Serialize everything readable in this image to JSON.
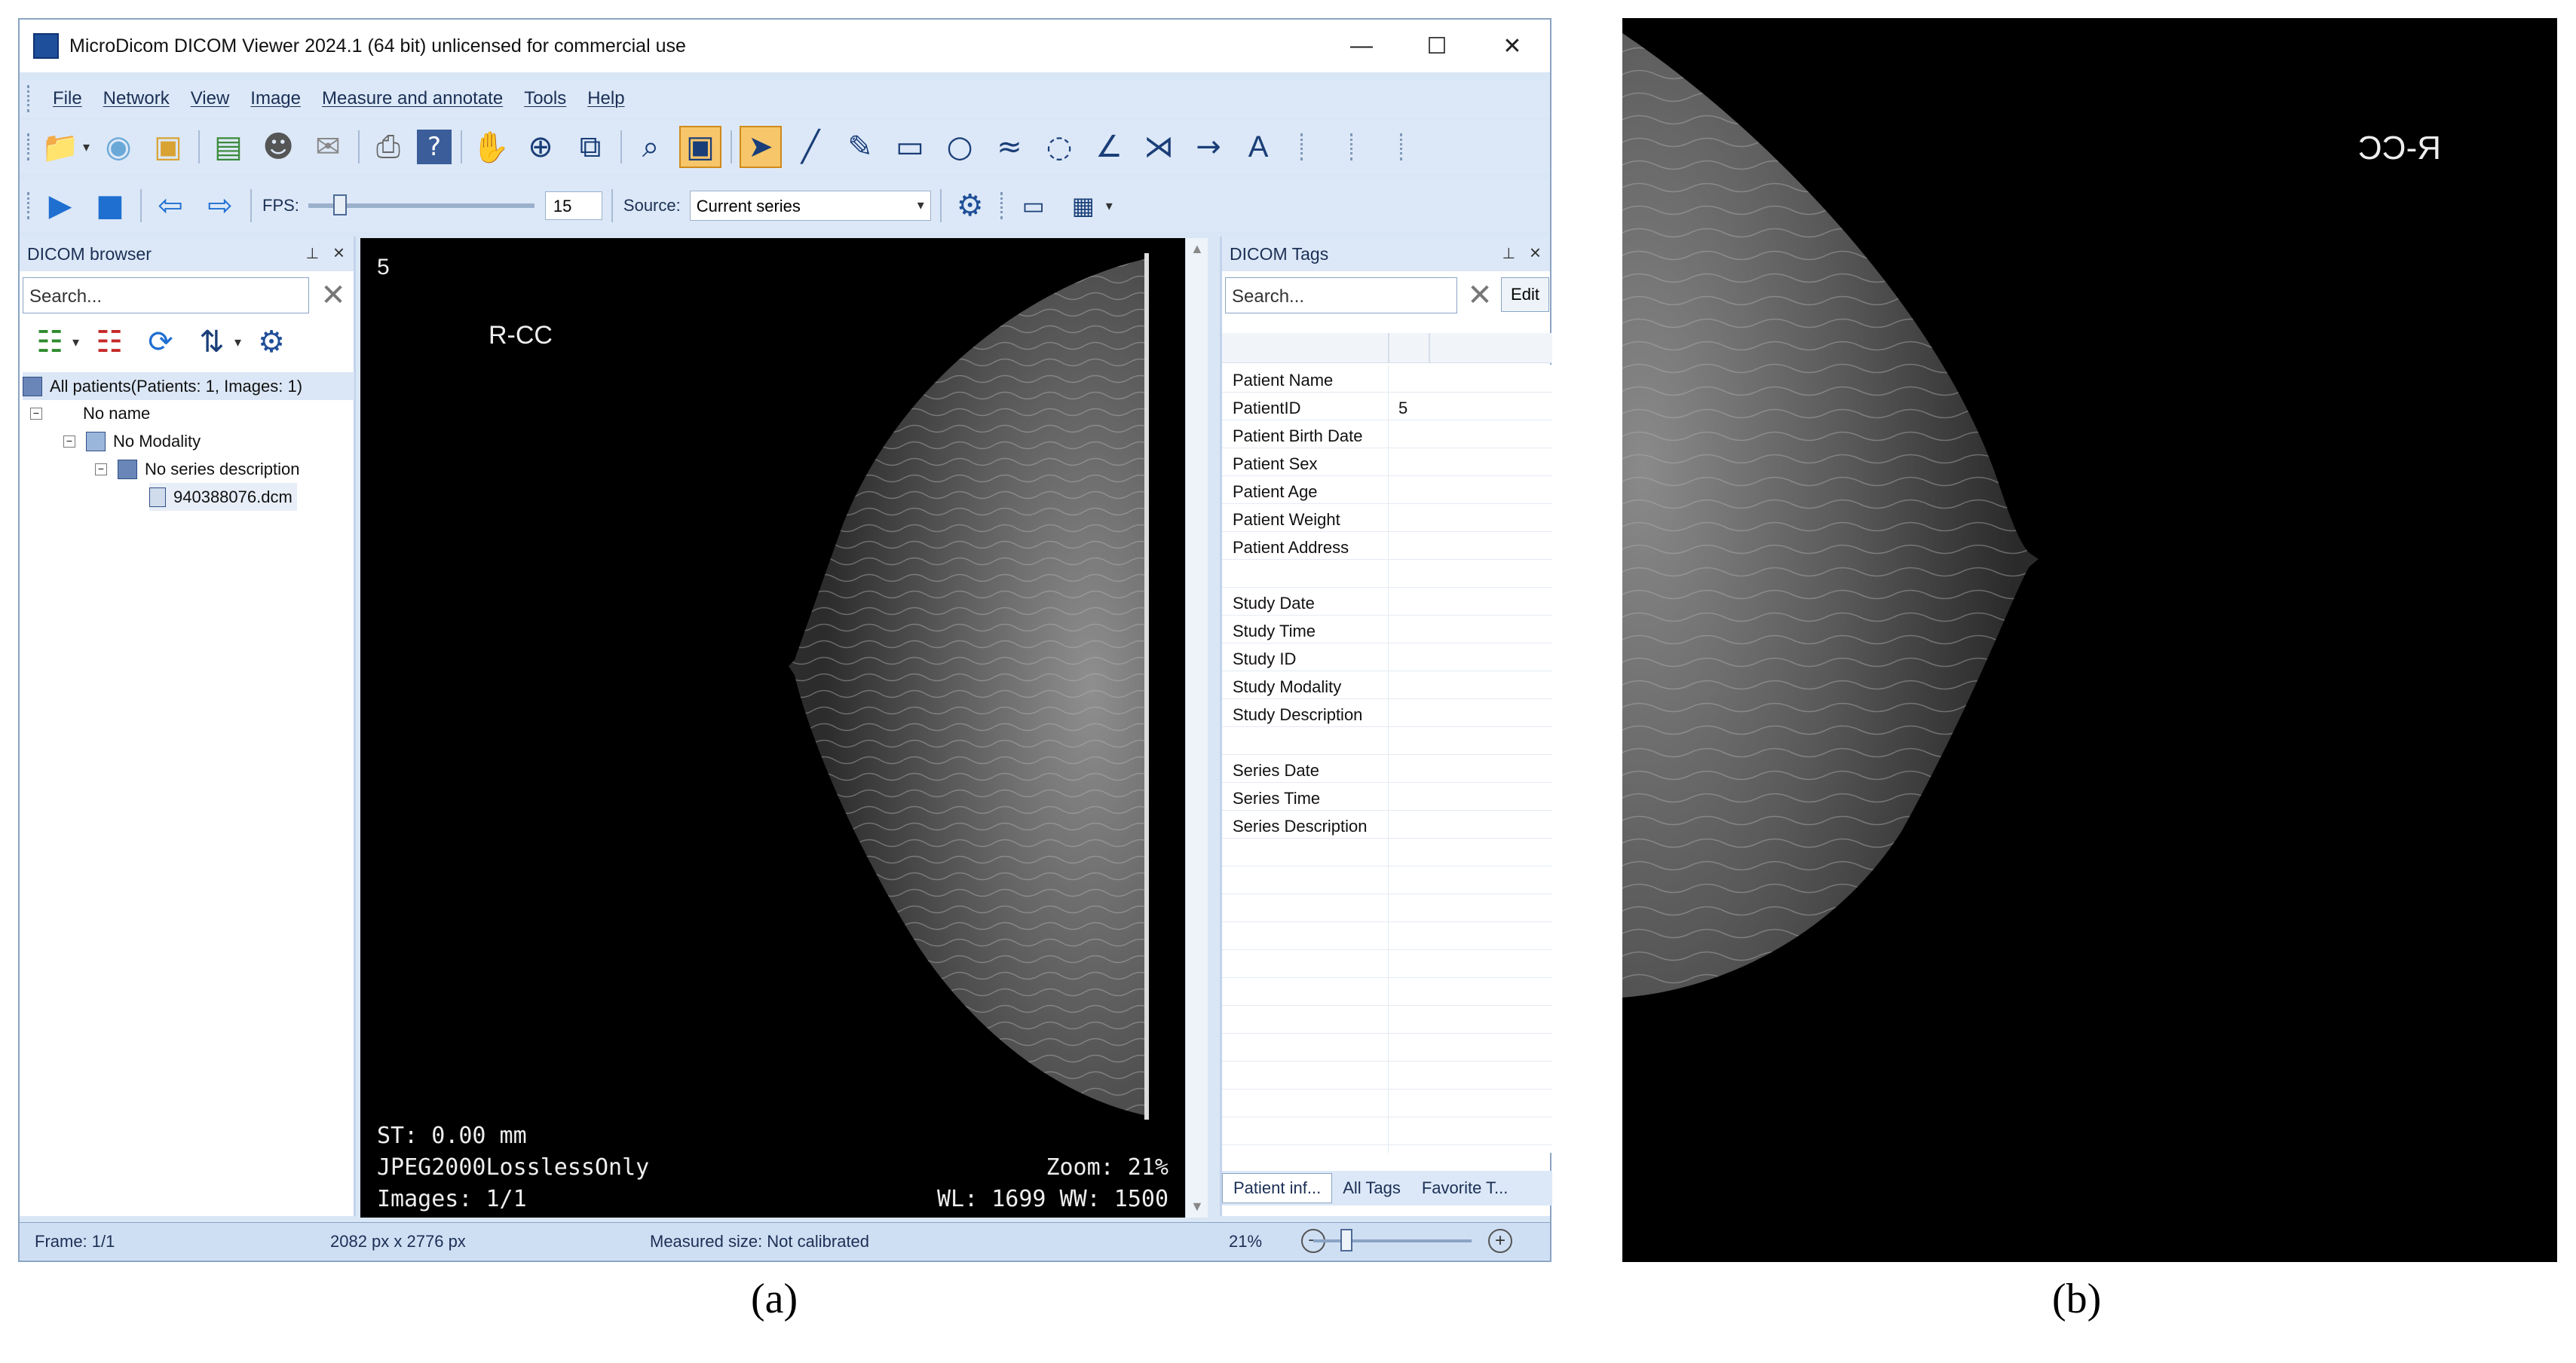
{
  "window": {
    "title": "MicroDicom DICOM Viewer 2024.1 (64 bit) unlicensed for commercial use",
    "controls": [
      "—",
      "☐",
      "✕"
    ]
  },
  "menu": [
    "File",
    "Network",
    "View",
    "Image",
    "Measure and annotate",
    "Tools",
    "Help"
  ],
  "toolbar2": {
    "fps_label": "FPS:",
    "fps_value": "15",
    "fps_slider_value": 0.11,
    "source_label": "Source:",
    "source_value": "Current series"
  },
  "dicom_browser": {
    "title": "DICOM browser",
    "search_placeholder": "Search...",
    "tree": [
      "All patients(Patients: 1, Images: 1)",
      "No name",
      "No Modality",
      "No series description",
      "940388076.dcm"
    ]
  },
  "viewer": {
    "frame_number": "5",
    "view_label": "R-CC",
    "st": "ST: 0.00 mm",
    "codec": "JPEG2000LosslessOnly",
    "images": "Images: 1/1",
    "zoom": "Zoom: 21%",
    "wl_ww": "WL: 1699 WW: 1500"
  },
  "dicom_tags": {
    "title": "DICOM Tags",
    "search_placeholder": "Search...",
    "edit_label": "Edit",
    "rows": [
      {
        "name": "Patient Name",
        "value": ""
      },
      {
        "name": "PatientID",
        "value": "5"
      },
      {
        "name": "Patient Birth Date",
        "value": ""
      },
      {
        "name": "Patient Sex",
        "value": ""
      },
      {
        "name": "Patient Age",
        "value": ""
      },
      {
        "name": "Patient Weight",
        "value": ""
      },
      {
        "name": "Patient Address",
        "value": ""
      },
      {
        "name": "",
        "value": ""
      },
      {
        "name": "Study Date",
        "value": ""
      },
      {
        "name": "Study Time",
        "value": ""
      },
      {
        "name": "Study ID",
        "value": ""
      },
      {
        "name": "Study Modality",
        "value": ""
      },
      {
        "name": "Study Description",
        "value": ""
      },
      {
        "name": "",
        "value": ""
      },
      {
        "name": "Series Date",
        "value": ""
      },
      {
        "name": "Series Time",
        "value": ""
      },
      {
        "name": "Series Description",
        "value": ""
      }
    ],
    "tabs": [
      "Patient inf...",
      "All Tags",
      "Favorite T..."
    ]
  },
  "status": {
    "frame": "Frame: 1/1",
    "size": "2082 px x 2776 px",
    "measured": "Measured size: Not calibrated",
    "zoom": "21%",
    "zoom_slider_value": 0.21
  },
  "panel_b": {
    "mirrored_label": "R-CC"
  },
  "captions": {
    "a": "(a)",
    "b": "(b)"
  },
  "icons": {
    "toolbar1": [
      "open-folder-icon",
      "cd-icon",
      "open-dicomdir-icon",
      "export-image-icon",
      "anonymize-icon",
      "send-email-icon",
      "print-icon",
      "help-icon",
      "pan-hand-icon",
      "zoom-icon",
      "copy-window-icon",
      "magnifier-icon",
      "fit-window-icon",
      "select-arrow-icon",
      "line-icon",
      "pencil-icon",
      "rectangle-icon",
      "ellipse-icon",
      "polyline-icon",
      "closed-curve-icon",
      "angle-icon",
      "cobb-angle-icon",
      "arrow-icon",
      "text-icon"
    ],
    "toolbar2": [
      "play-icon",
      "stop-icon",
      "previous-icon",
      "next-icon",
      "settings-gear-icon",
      "screen-icon",
      "layout-grid-icon"
    ],
    "browser": [
      "add-series-icon",
      "remove-series-icon",
      "refresh-icon",
      "sort-icon",
      "browser-settings-icon"
    ]
  }
}
